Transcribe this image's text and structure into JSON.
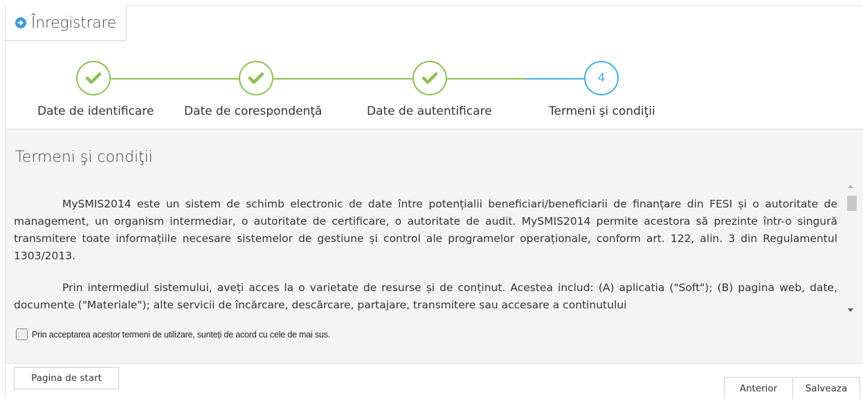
{
  "header": {
    "tab_label": "Înregistrare",
    "tab_icon": "circle-arrow-right-icon"
  },
  "wizard": {
    "steps": [
      {
        "label": "Date de identificare",
        "state": "done",
        "marker": "✓"
      },
      {
        "label": "Date de corespondenţă",
        "state": "done",
        "marker": "✓"
      },
      {
        "label": "Date de autentificare",
        "state": "done",
        "marker": "✓"
      },
      {
        "label": "Termeni şi condiţii",
        "state": "active",
        "marker": "4"
      }
    ],
    "colors": {
      "done": "#8cc152",
      "active": "#3bb1e9"
    }
  },
  "main": {
    "title": "Termeni şi condiţii",
    "paragraphs": [
      "MySMIS2014 este un sistem de schimb electronic de date între potențialii beneficiari/beneficiarii de finanțare din FESI și o autoritate de management, un organism intermediar, o autoritate de certificare, o autoritate de audit. MySMIS2014 permite acestora să prezinte într-o singură transmitere toate informațiile necesare sistemelor de gestiune și control ale programelor operaționale, conform art. 122, alin. 3 din Regulamentul 1303/2013.",
      "Prin intermediul sistemului, aveți acces la o varietate de resurse și de conținut. Acestea includ: (A) aplicatia (\"Soft\"); (B) pagina web, date, documente (\"Materiale\"); alte servicii de încărcare, descărcare, partajare, transmitere sau accesare a continutului"
    ],
    "accept_label": "Prin acceptarea acestor termeni de utilizare, sunteți de acord cu cele de mai sus.",
    "accept_checked": false
  },
  "footer": {
    "home_button": "Pagina de start",
    "prev_button": "Anterior",
    "save_button": "Salveaza"
  }
}
